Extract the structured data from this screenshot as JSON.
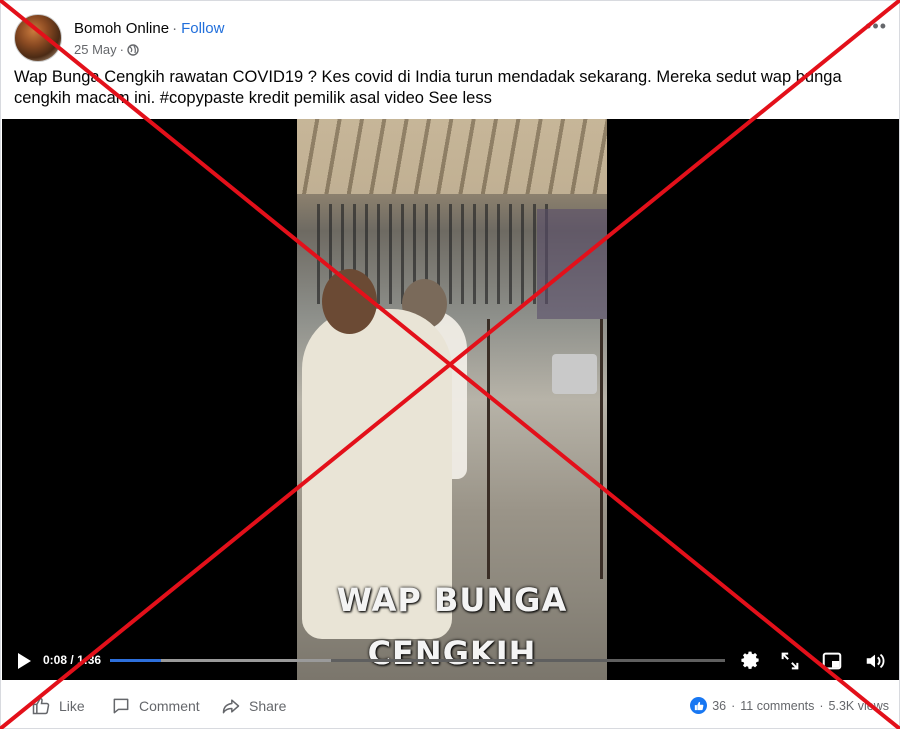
{
  "post": {
    "page_name": "Bomoh Online",
    "separator": "·",
    "follow_label": "Follow",
    "date": "25 May",
    "meta_separator": "·",
    "privacy_icon": "globe-icon",
    "more_icon": "more-horizontal-icon",
    "more_label": "•••",
    "caption": "Wap Bunga Cengkih rawatan COVID19 ? Kes covid di India turun mendadak sekarang. Mereka sedut wap bunga cengkih macam ini. #copypaste kredit pemilik asal video",
    "see_less_label": "See less"
  },
  "video": {
    "overlay_line1": "WAP BUNGA",
    "overlay_line2": "CENGKIH",
    "current_time": "0:08",
    "time_separator": "/",
    "duration": "1:36",
    "progress_played_fraction": 0.083,
    "progress_buffered_fraction": 0.36,
    "icons": [
      "play-icon",
      "settings-icon",
      "fullscreen-icon",
      "picture-in-picture-icon",
      "volume-icon"
    ]
  },
  "actions": {
    "like_label": "Like",
    "comment_label": "Comment",
    "share_label": "Share",
    "reaction_count": "36",
    "comments_count": "11 comments",
    "views_count": "5.3K views",
    "stat_separator": "·"
  },
  "overlay": {
    "cross_color": "#e3101a",
    "meaning": "crossed-out"
  },
  "colors": {
    "link_blue": "#216fdb",
    "like_blue": "#1877f2",
    "secondary_text": "#65676b"
  }
}
